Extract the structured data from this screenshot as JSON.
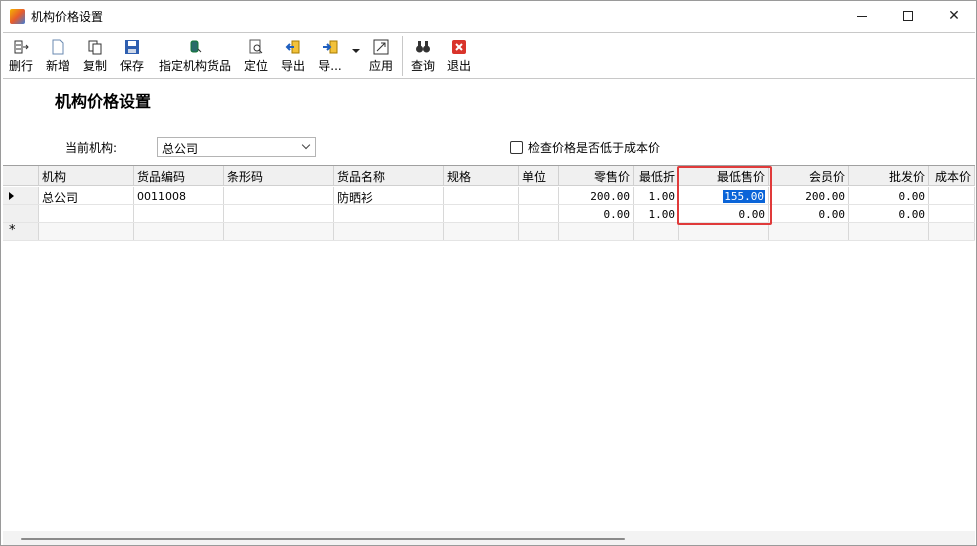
{
  "window": {
    "title": "机构价格设置"
  },
  "toolbar": {
    "delete_row": "删行",
    "new": "新增",
    "copy": "复制",
    "save": "保存",
    "assign_goods": "指定机构货品",
    "locate": "定位",
    "export": "导出",
    "import": "导...",
    "apply": "应用",
    "query": "查询",
    "exit": "退出"
  },
  "form": {
    "heading": "机构价格设置",
    "org_label": "当前机构:",
    "org_value": "总公司",
    "check_label": "检查价格是否低于成本价"
  },
  "grid": {
    "headers": [
      "机构",
      "货品编码",
      "条形码",
      "货品名称",
      "规格",
      "单位",
      "零售价",
      "最低折",
      "最低售价",
      "会员价",
      "批发价",
      "成本价"
    ],
    "rows": [
      [
        "总公司",
        "0011008",
        "",
        "防晒衫",
        "",
        "",
        "200.00",
        "1.00",
        "155.00",
        "200.00",
        "0.00",
        ""
      ],
      [
        "",
        "",
        "",
        "",
        "",
        "",
        "0.00",
        "1.00",
        "0.00",
        "0.00",
        "0.00",
        ""
      ]
    ],
    "new_row_marker": "*"
  },
  "colors": {
    "highlight": "#e03a3a",
    "selection": "#0a64d8"
  }
}
